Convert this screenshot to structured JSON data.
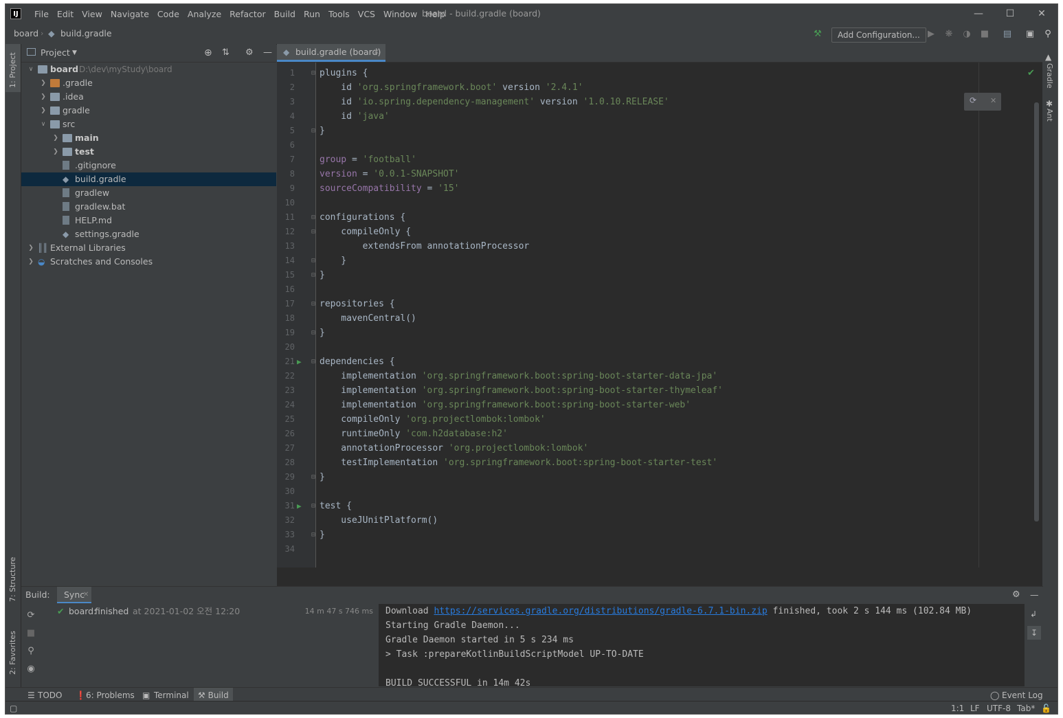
{
  "titlebar": {
    "logo": "IJ",
    "menu": [
      "File",
      "Edit",
      "View",
      "Navigate",
      "Code",
      "Analyze",
      "Refactor",
      "Build",
      "Run",
      "Tools",
      "VCS",
      "Window",
      "Help"
    ],
    "window_title": "board - build.gradle (board)",
    "controls": [
      "minimize-icon",
      "maximize-icon",
      "close-icon"
    ]
  },
  "navbar": {
    "crumb_project": "board",
    "crumb_file": "build.gradle",
    "add_config_label": "Add Configuration...",
    "icons": [
      "hammer-icon",
      "run-icon",
      "debug-icon",
      "coverage-icon",
      "stop-icon",
      "project-structure-icon",
      "presentation-icon",
      "search-icon"
    ]
  },
  "stripes": {
    "left_top": "1: Project",
    "left_structure": "7: Structure",
    "left_favorites": "2: Favorites",
    "right_gradle": "Gradle",
    "right_ant": "Ant"
  },
  "project": {
    "header_title": "Project",
    "tree": [
      {
        "label": "board",
        "extra": "D:\\dev\\myStudy\\board",
        "depth": 0,
        "arrow": "open",
        "icon": "folder",
        "bold": true
      },
      {
        "label": ".gradle",
        "depth": 1,
        "arrow": "closed",
        "icon": "folder-orange"
      },
      {
        "label": ".idea",
        "depth": 1,
        "arrow": "closed",
        "icon": "folder"
      },
      {
        "label": "gradle",
        "depth": 1,
        "arrow": "closed",
        "icon": "folder"
      },
      {
        "label": "src",
        "depth": 1,
        "arrow": "open",
        "icon": "folder"
      },
      {
        "label": "main",
        "depth": 2,
        "arrow": "closed",
        "icon": "folder",
        "bold": true
      },
      {
        "label": "test",
        "depth": 2,
        "arrow": "closed",
        "icon": "folder",
        "bold": true
      },
      {
        "label": ".gitignore",
        "depth": 2,
        "arrow": "none",
        "icon": "file"
      },
      {
        "label": "build.gradle",
        "depth": 2,
        "arrow": "none",
        "icon": "gradle",
        "selected": true
      },
      {
        "label": "gradlew",
        "depth": 2,
        "arrow": "none",
        "icon": "file"
      },
      {
        "label": "gradlew.bat",
        "depth": 2,
        "arrow": "none",
        "icon": "file"
      },
      {
        "label": "HELP.md",
        "depth": 2,
        "arrow": "none",
        "icon": "file"
      },
      {
        "label": "settings.gradle",
        "depth": 2,
        "arrow": "none",
        "icon": "gradle"
      },
      {
        "label": "External Libraries",
        "depth": 0,
        "arrow": "closed",
        "icon": "library"
      },
      {
        "label": "Scratches and Consoles",
        "depth": 0,
        "arrow": "closed",
        "icon": "scratch"
      }
    ]
  },
  "editor": {
    "tab_label": "build.gradle (board)",
    "lines": [
      [
        {
          "t": "plugins {"
        }
      ],
      [
        {
          "t": "    id "
        },
        {
          "t": "'org.springframework.boot'",
          "c": "str"
        },
        {
          "t": " version "
        },
        {
          "t": "'2.4.1'",
          "c": "str"
        }
      ],
      [
        {
          "t": "    id "
        },
        {
          "t": "'io.spring.dependency-management'",
          "c": "str"
        },
        {
          "t": " version "
        },
        {
          "t": "'1.0.10.RELEASE'",
          "c": "str"
        }
      ],
      [
        {
          "t": "    id "
        },
        {
          "t": "'java'",
          "c": "str"
        }
      ],
      [
        {
          "t": "}"
        }
      ],
      [],
      [
        {
          "t": "group",
          "c": "prop"
        },
        {
          "t": " = "
        },
        {
          "t": "'football'",
          "c": "str"
        }
      ],
      [
        {
          "t": "version",
          "c": "prop"
        },
        {
          "t": " = "
        },
        {
          "t": "'0.0.1-SNAPSHOT'",
          "c": "str"
        }
      ],
      [
        {
          "t": "sourceCompatibility",
          "c": "prop"
        },
        {
          "t": " = "
        },
        {
          "t": "'15'",
          "c": "str"
        }
      ],
      [],
      [
        {
          "t": "configurations {"
        }
      ],
      [
        {
          "t": "    compileOnly {"
        }
      ],
      [
        {
          "t": "        extendsFrom annotationProcessor"
        }
      ],
      [
        {
          "t": "    }"
        }
      ],
      [
        {
          "t": "}"
        }
      ],
      [],
      [
        {
          "t": "repositories {"
        }
      ],
      [
        {
          "t": "    mavenCentral()"
        }
      ],
      [
        {
          "t": "}"
        }
      ],
      [],
      [
        {
          "t": "dependencies {"
        }
      ],
      [
        {
          "t": "    implementation "
        },
        {
          "t": "'org.springframework.boot:spring-boot-starter-data-jpa'",
          "c": "str"
        }
      ],
      [
        {
          "t": "    implementation "
        },
        {
          "t": "'org.springframework.boot:spring-boot-starter-thymeleaf'",
          "c": "str"
        }
      ],
      [
        {
          "t": "    implementation "
        },
        {
          "t": "'org.springframework.boot:spring-boot-starter-web'",
          "c": "str"
        }
      ],
      [
        {
          "t": "    compileOnly "
        },
        {
          "t": "'org.projectlombok:lombok'",
          "c": "str"
        }
      ],
      [
        {
          "t": "    runtimeOnly "
        },
        {
          "t": "'com.h2database:h2'",
          "c": "str"
        }
      ],
      [
        {
          "t": "    annotationProcessor "
        },
        {
          "t": "'org.projectlombok:lombok'",
          "c": "str"
        }
      ],
      [
        {
          "t": "    testImplementation "
        },
        {
          "t": "'org.springframework.boot:spring-boot-starter-test'",
          "c": "str"
        }
      ],
      [
        {
          "t": "}"
        }
      ],
      [],
      [
        {
          "t": "test {"
        }
      ],
      [
        {
          "t": "    useJUnitPlatform()"
        }
      ],
      [
        {
          "t": "}"
        }
      ],
      []
    ],
    "fold_lines": [
      1,
      5,
      11,
      12,
      14,
      15,
      17,
      19,
      21,
      29,
      31,
      33
    ],
    "run_lines": [
      21,
      31
    ]
  },
  "build": {
    "label": "Build:",
    "tab": "Sync",
    "result_name": "board:",
    "result_text": " finished",
    "result_time": "at 2021-01-02 오전 12:20",
    "duration": "14 m 47 s 746 ms",
    "output": [
      {
        "pre": "Download ",
        "link": "https://services.gradle.org/distributions/gradle-6.7.1-bin.zip",
        "post": " finished, took 2 s 144 ms (102.84 MB)"
      },
      {
        "pre": "Starting Gradle Daemon..."
      },
      {
        "pre": "Gradle Daemon started in 5 s 234 ms"
      },
      {
        "pre": "> Task :prepareKotlinBuildScriptModel UP-TO-DATE"
      },
      {
        "pre": ""
      },
      {
        "pre": "BUILD SUCCESSFUL in 14m 42s"
      }
    ]
  },
  "bottombar": {
    "todo": "TODO",
    "problems": "6: Problems",
    "terminal": "Terminal",
    "build": "Build",
    "event_log": "Event Log"
  },
  "statusbar": {
    "position": "1:1",
    "line_sep": "LF",
    "encoding": "UTF-8",
    "indent": "Tab*"
  },
  "colors": {
    "accent": "#4a88c7",
    "string": "#6a8759",
    "property": "#9876aa",
    "success": "#499c54"
  }
}
